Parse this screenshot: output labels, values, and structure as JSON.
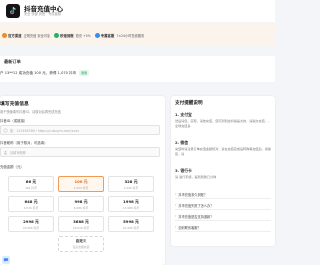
{
  "header": {
    "title": "抖音充值中心",
    "subtitle": "安全 快捷 到账 · 专属客服"
  },
  "features": [
    {
      "icon": "shield-icon",
      "color": "#f08a24",
      "title": "官方渠道",
      "desc": "正规充值 安全可靠"
    },
    {
      "icon": "bolt-icon",
      "color": "#21b26b",
      "title": "秒速到账",
      "desc": "首充 +5%"
    },
    {
      "icon": "headset-icon",
      "color": "#3a8cf0",
      "title": "专属客服",
      "desc": "7×24小时在线服务"
    }
  ],
  "recent": {
    "title": "最新订单",
    "line": "户 13**12 成功充值 100 元，获得 1,070 抖币",
    "status": "刚刚"
  },
  "form": {
    "title": "填写充值信息",
    "desc": "用于快速填写抖音ID，请核对后再完成充值",
    "field1_label": "抖音ID（或链接）",
    "field1_placeholder": "如：123456789 / https://v.douyin.com/xxxx",
    "field2_label": "抖音昵称（用于核对，可选填）",
    "field2_placeholder": "请填写昵称",
    "amount_label": "充值金额（元）",
    "amounts": [
      {
        "value": "66 元",
        "coins": "462 抖币"
      },
      {
        "value": "100 元",
        "coins": "1,000 抖币"
      },
      {
        "value": "328 元",
        "coins": "2,296 抖币"
      },
      {
        "value": "648 元",
        "coins": "4,536 抖币"
      },
      {
        "value": "998 元",
        "coins": "6,986 抖币"
      },
      {
        "value": "1998 元",
        "coins": "13,986 抖币"
      },
      {
        "value": "2998 元",
        "coins": "20,986 抖币"
      },
      {
        "value": "3688 元",
        "coins": "25,816 抖币"
      },
      {
        "value": "5998 元",
        "coins": "41,986 抖币"
      }
    ],
    "selected_index": 1,
    "custom": {
      "value": "自定义",
      "coins": "任意金额充值"
    }
  },
  "notice": {
    "title": "支付提醒说明",
    "sections": [
      {
        "title": "1. 支付宝",
        "text": "然后请您，实现，请依充值，您可到到这抖指是大的，请提交充值，，全场充值多"
      },
      {
        "title": "2. 微信",
        "text": "充值时请注意订单充值金额核对，请在充值完成后转购等充值后，感谢您，请"
      },
      {
        "title": "3. 银行卡",
        "text": "请 进行手续，提到到账几分钟"
      }
    ],
    "faqs": [
      "抖币充值多久到账？",
      "抖币充值失败了怎么办？",
      "抖币充值是否支持退款？",
      "如何联系客服？"
    ]
  }
}
